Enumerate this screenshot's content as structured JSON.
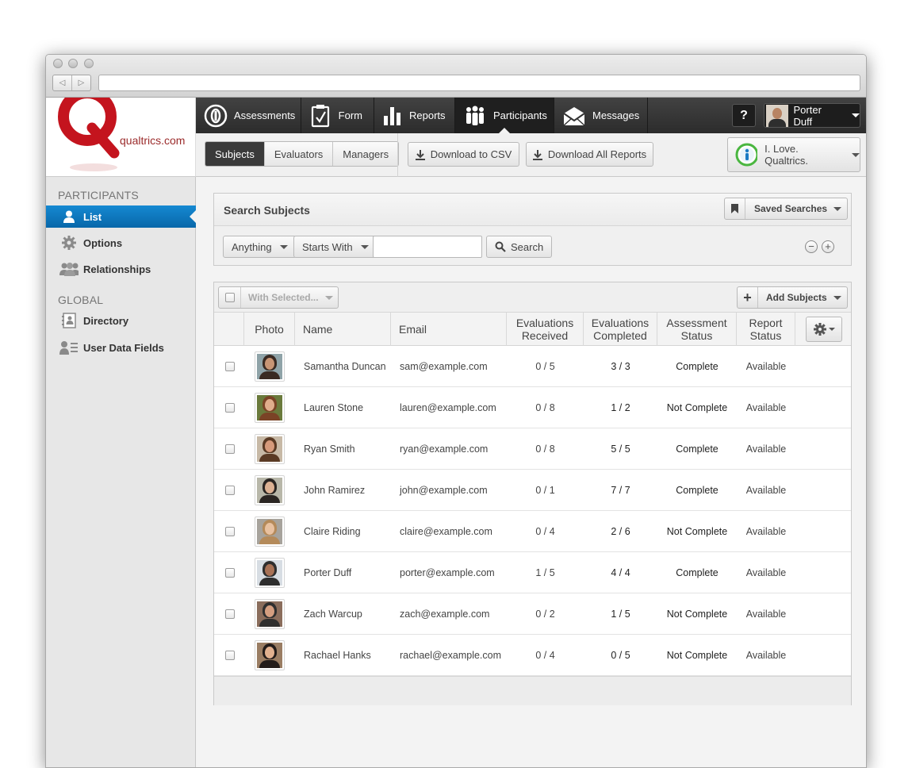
{
  "app": {
    "logo_text": "qualtrics.com",
    "logo_letter": "Q",
    "colors": {
      "brand_red": "#c4141e",
      "accent_blue": "#0f7bc6",
      "nav_dark": "#333333"
    }
  },
  "topnav": {
    "tabs": [
      {
        "label": "Assessments",
        "icon": "assessments-icon"
      },
      {
        "label": "Form",
        "icon": "form-clipboard-icon"
      },
      {
        "label": "Reports",
        "icon": "bar-chart-icon"
      },
      {
        "label": "Participants",
        "icon": "people-icon",
        "active": true
      },
      {
        "label": "Messages",
        "icon": "envelope-icon"
      }
    ],
    "help_label": "?",
    "user_name": "Porter Duff"
  },
  "subnav": {
    "segments": [
      {
        "label": "Subjects",
        "active": true
      },
      {
        "label": "Evaluators"
      },
      {
        "label": "Managers"
      }
    ],
    "download_csv": "Download to CSV",
    "download_reports": "Download All Reports",
    "project_name": "I. Love. Qualtrics."
  },
  "sidebar": {
    "section_participants": "PARTICIPANTS",
    "participant_items": [
      {
        "label": "List",
        "icon": "person-icon",
        "active": true
      },
      {
        "label": "Options",
        "icon": "gear-icon"
      },
      {
        "label": "Relationships",
        "icon": "group-icon"
      }
    ],
    "section_global": "GLOBAL",
    "global_items": [
      {
        "label": "Directory",
        "icon": "directory-icon"
      },
      {
        "label": "User Data Fields",
        "icon": "user-fields-icon"
      }
    ]
  },
  "search": {
    "title": "Search Subjects",
    "saved_searches": "Saved Searches",
    "field_select": "Anything",
    "match_select": "Starts With",
    "query_value": "",
    "search_button": "Search",
    "remove_label": "−",
    "add_label": "+"
  },
  "grid": {
    "with_selected": "With Selected...",
    "add_subjects": "Add Subjects",
    "add_icon": "+",
    "columns": [
      "Photo",
      "Name",
      "Email",
      "Evaluations Received",
      "Evaluations Completed",
      "Assessment Status",
      "Report Status"
    ],
    "rows": [
      {
        "name": "Samantha Duncan",
        "email": "sam@example.com",
        "received": "0 / 5",
        "completed": "3 / 3",
        "assessment": "Complete",
        "report": "Available"
      },
      {
        "name": "Lauren Stone",
        "email": "lauren@example.com",
        "received": "0 / 8",
        "completed": "1 / 2",
        "assessment": "Not Complete",
        "report": "Available"
      },
      {
        "name": "Ryan Smith",
        "email": "ryan@example.com",
        "received": "0 / 8",
        "completed": "5 / 5",
        "assessment": "Complete",
        "report": "Available"
      },
      {
        "name": "John Ramirez",
        "email": "john@example.com",
        "received": "0 / 1",
        "completed": "7 / 7",
        "assessment": "Complete",
        "report": "Available"
      },
      {
        "name": "Claire Riding",
        "email": "claire@example.com",
        "received": "0 / 4",
        "completed": "2 / 6",
        "assessment": "Not Complete",
        "report": "Available"
      },
      {
        "name": "Porter Duff",
        "email": "porter@example.com",
        "received": "1 / 5",
        "completed": "4 / 4",
        "assessment": "Complete",
        "report": "Available"
      },
      {
        "name": "Zach Warcup",
        "email": "zach@example.com",
        "received": "0 / 2",
        "completed": "1 / 5",
        "assessment": "Not Complete",
        "report": "Available"
      },
      {
        "name": "Rachael Hanks",
        "email": "rachael@example.com",
        "received": "0 / 4",
        "completed": "0 / 5",
        "assessment": "Not Complete",
        "report": "Available"
      }
    ]
  }
}
